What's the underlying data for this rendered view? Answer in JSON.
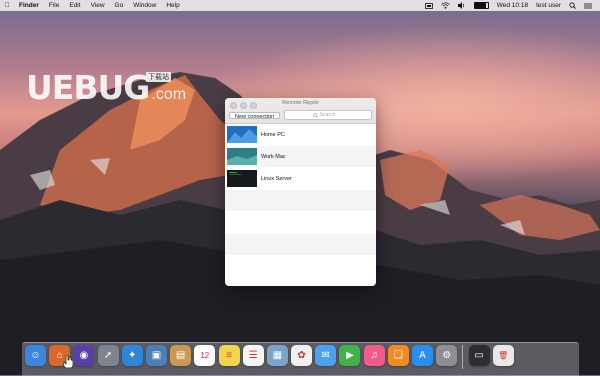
{
  "menubar": {
    "apple_icon": "apple-icon",
    "app_name": "Finder",
    "items": [
      "File",
      "Edit",
      "View",
      "Go",
      "Window",
      "Help"
    ],
    "status": {
      "clock": "Wed 10:18",
      "user": "test user",
      "battery_fraction": 0.9
    }
  },
  "watermark": {
    "text": "UEBUG",
    "domain": ".com",
    "badge": "下载站"
  },
  "window": {
    "title": "Remote Ripple",
    "new_button_label": "New connection",
    "search_placeholder": "Search",
    "connections": [
      {
        "name": "Home PC",
        "thumb_color": "#2a8ad6"
      },
      {
        "name": "Work Mac",
        "thumb_color": "#3f9b9a"
      },
      {
        "name": "Linux Server",
        "thumb_color": "#1a2224"
      }
    ]
  },
  "dock": {
    "apps": [
      {
        "name": "finder",
        "color": "#3c86e0",
        "glyph": "☺"
      },
      {
        "name": "remote-ripple",
        "color": "#d96a2a",
        "glyph": "⌂"
      },
      {
        "name": "siri",
        "color": "#5b3fa8",
        "glyph": "◉"
      },
      {
        "name": "launchpad",
        "color": "#7d8590",
        "glyph": "➚"
      },
      {
        "name": "safari",
        "color": "#2f86d6",
        "glyph": "✦"
      },
      {
        "name": "preview",
        "color": "#4b7fb8",
        "glyph": "▣"
      },
      {
        "name": "notes",
        "color": "#c89a52",
        "glyph": "▤"
      },
      {
        "name": "calendar",
        "color": "#ffffff",
        "glyph": "12"
      },
      {
        "name": "stickies",
        "color": "#f2d54a",
        "glyph": "≡"
      },
      {
        "name": "reminders",
        "color": "#f5f5f5",
        "glyph": "☰"
      },
      {
        "name": "photo-booth",
        "color": "#7aa5c8",
        "glyph": "▦"
      },
      {
        "name": "photos",
        "color": "#f0f0f0",
        "glyph": "✿"
      },
      {
        "name": "messages",
        "color": "#4aa3f0",
        "glyph": "✉"
      },
      {
        "name": "facetime",
        "color": "#3fb24a",
        "glyph": "▶"
      },
      {
        "name": "itunes",
        "color": "#f05b8a",
        "glyph": "♫"
      },
      {
        "name": "ibooks",
        "color": "#f08a24",
        "glyph": "❏"
      },
      {
        "name": "app-store",
        "color": "#2a8ef0",
        "glyph": "A"
      },
      {
        "name": "system-preferences",
        "color": "#8d8f94",
        "glyph": "⚙"
      }
    ],
    "right_items": [
      {
        "name": "downloads",
        "color": "#2b2f33",
        "glyph": "▭"
      },
      {
        "name": "trash",
        "color": "#e6e8ea",
        "glyph": "🗑"
      }
    ]
  }
}
